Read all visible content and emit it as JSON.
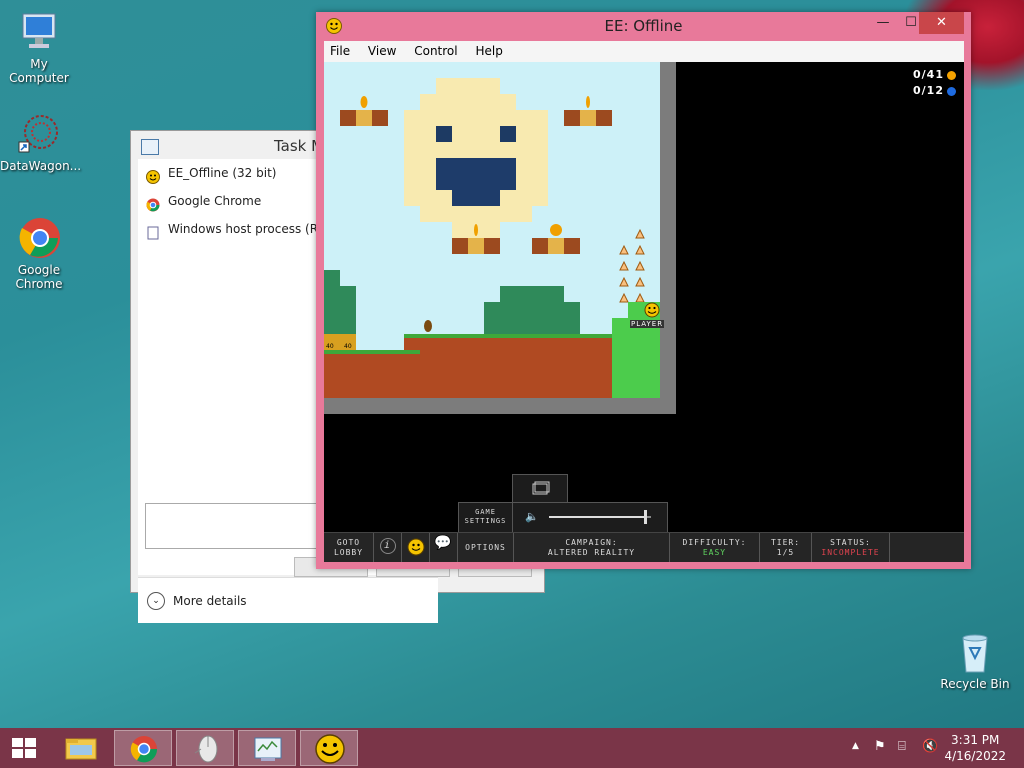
{
  "desktop": {
    "icons": [
      {
        "label": "My Computer"
      },
      {
        "label": "DataWagon..."
      },
      {
        "label": "Google Chrome"
      },
      {
        "label": "Recycle Bin"
      }
    ]
  },
  "task_manager": {
    "title": "Task M",
    "rows": [
      {
        "label": "EE_Offline (32 bit)",
        "icon": "smiley-icon"
      },
      {
        "label": "Google Chrome",
        "icon": "chrome-icon"
      },
      {
        "label": "Windows host process (Rund",
        "icon": "document-icon"
      }
    ],
    "more_details": "More details"
  },
  "ee_window": {
    "title": "EE: Offline",
    "menu": [
      "File",
      "View",
      "Control",
      "Help"
    ],
    "counters": {
      "coins": "0/41",
      "blue": "0/12",
      "coin_color": "#f5a200",
      "blue_color": "#1e6be0"
    },
    "player_label": "PLAYER",
    "tile_labels": [
      "40",
      "40"
    ],
    "bottom_bar": {
      "goto_lobby": "GOTO\nLOBBY",
      "options": "OPTIONS",
      "game_settings": "GAME\nSETTINGS",
      "campaign_label": "CAMPAIGN:",
      "campaign_value": "ALTERED REALITY",
      "difficulty_label": "DIFFICULTY:",
      "difficulty_value": "EASY",
      "difficulty_color": "#5fd35f",
      "tier_label": "TIER:",
      "tier_value": "1/5",
      "status_label": "STATUS:",
      "status_value": "INCOMPLETE",
      "status_color": "#e0434f"
    },
    "volume": 0.95
  },
  "taskbar": {
    "apps": [
      "start-icon",
      "file-explorer-icon",
      "chrome-icon",
      "mouse-icon",
      "task-manager-icon",
      "smiley-icon"
    ],
    "time": "3:31 PM",
    "date": "4/16/2022"
  }
}
